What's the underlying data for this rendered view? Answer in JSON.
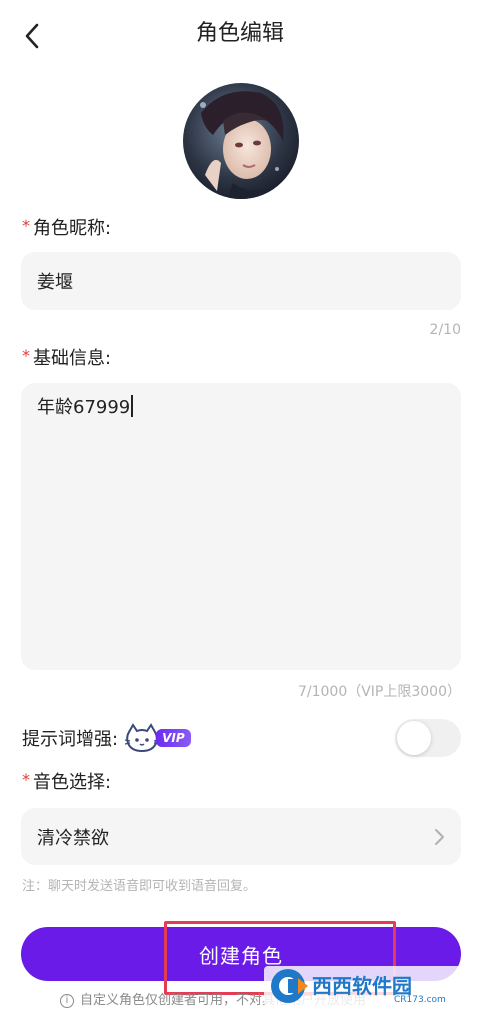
{
  "header": {
    "title": "角色编辑"
  },
  "form": {
    "required_mark": "*",
    "name_label": "角色昵称:",
    "name_value": "姜堰",
    "name_counter": "2/10",
    "info_label": "基础信息:",
    "info_value": "年龄67999",
    "info_counter": "7/1000（VIP上限3000）",
    "enhance_label": "提示词增强:",
    "vip_badge": "VIP",
    "enhance_enabled": false,
    "voice_label": "音色选择:",
    "voice_value": "清冷禁欲",
    "note": "注：聊天时发送语音即可收到语音回复。"
  },
  "actions": {
    "create_label": "创建角色",
    "footer_info_glyph": "i",
    "footer_note": "自定义角色仅创建者可用，不对其他用户开放使用"
  },
  "watermark": {
    "brand": "西西软件园",
    "domain": "CR173.com"
  },
  "colors": {
    "accent": "#6a1be8",
    "required": "#e53935",
    "field_bg": "#f5f5f5",
    "highlight": "#e63b55"
  }
}
